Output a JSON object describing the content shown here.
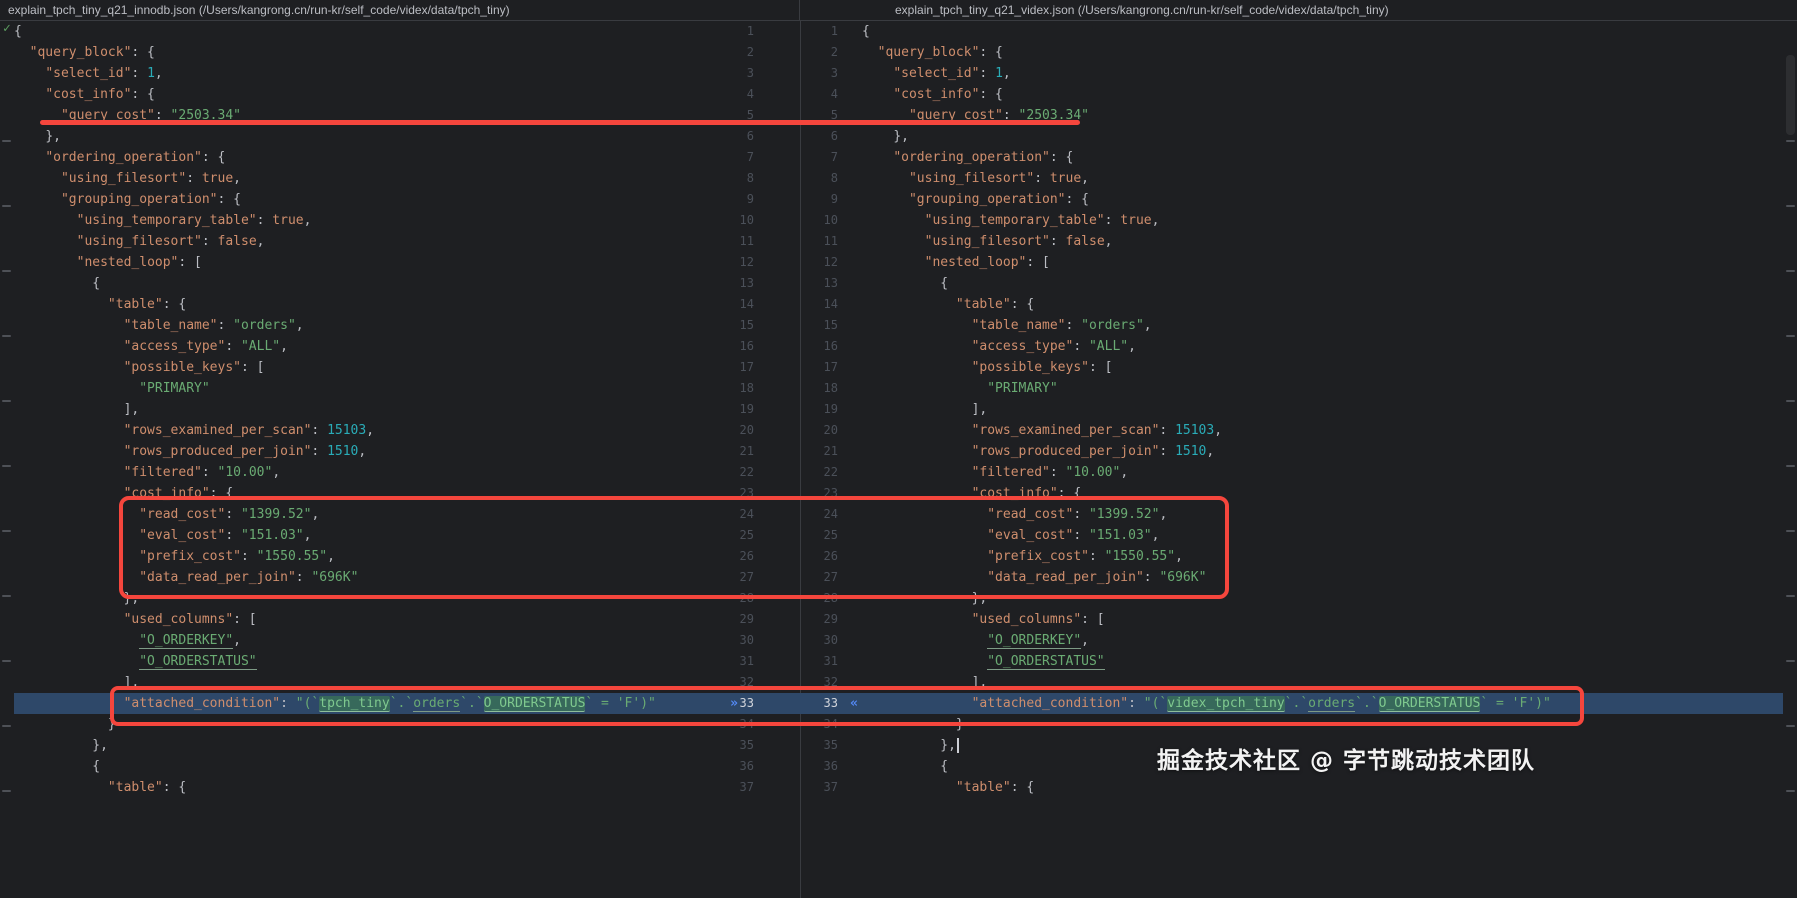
{
  "left_pane": {
    "header": "explain_tpch_tiny_q21_innodb.json (/Users/kangrong.cn/run-kr/self_code/videx/data/tpch_tiny)"
  },
  "right_pane": {
    "header": "explain_tpch_tiny_q21_videx.json (/Users/kangrong.cn/run-kr/self_code/videx/data/tpch_tiny)"
  },
  "watermark": "掘金技术社区 @ 字节跳动技术团队",
  "icons": {
    "inspection_ok": "✓",
    "chevron_next": "»",
    "chevron_prev": "«"
  },
  "colors": {
    "bg": "#1E1F22",
    "border": "#393B40",
    "header_fg": "#BCBEC4",
    "key": "#CF8E6D",
    "string": "#6AAB73",
    "number": "#2AACB8",
    "bool": "#CF8E6D",
    "punct": "#BCBEC4",
    "line_number": "#4B5059",
    "changed_line_bg": "#2E4869",
    "word_change_bg": "#37695B",
    "annotation": "#F5463D",
    "chevron": "#548AF7",
    "check": "#5C9E60"
  },
  "editor": {
    "lines": [
      {
        "n": 1,
        "t": [
          [
            "pun",
            "{"
          ]
        ]
      },
      {
        "n": 2,
        "t": [
          [
            "ws",
            "  "
          ],
          [
            "key",
            "\"query_block\""
          ],
          [
            "pun",
            ": {"
          ]
        ]
      },
      {
        "n": 3,
        "t": [
          [
            "ws",
            "    "
          ],
          [
            "key",
            "\"select_id\""
          ],
          [
            "pun",
            ": "
          ],
          [
            "num",
            "1"
          ],
          [
            "pun",
            ","
          ]
        ]
      },
      {
        "n": 4,
        "t": [
          [
            "ws",
            "    "
          ],
          [
            "key",
            "\"cost_info\""
          ],
          [
            "pun",
            ": {"
          ]
        ]
      },
      {
        "n": 5,
        "t": [
          [
            "ws",
            "      "
          ],
          [
            "key",
            "\"query_cost\""
          ],
          [
            "pun",
            ": "
          ],
          [
            "str",
            "\"2503.34\""
          ]
        ]
      },
      {
        "n": 6,
        "t": [
          [
            "ws",
            "    "
          ],
          [
            "pun",
            "},"
          ]
        ]
      },
      {
        "n": 7,
        "t": [
          [
            "ws",
            "    "
          ],
          [
            "key",
            "\"ordering_operation\""
          ],
          [
            "pun",
            ": {"
          ]
        ]
      },
      {
        "n": 8,
        "t": [
          [
            "ws",
            "      "
          ],
          [
            "key",
            "\"using_filesort\""
          ],
          [
            "pun",
            ": "
          ],
          [
            "bool",
            "true"
          ],
          [
            "pun",
            ","
          ]
        ]
      },
      {
        "n": 9,
        "t": [
          [
            "ws",
            "      "
          ],
          [
            "key",
            "\"grouping_operation\""
          ],
          [
            "pun",
            ": {"
          ]
        ]
      },
      {
        "n": 10,
        "t": [
          [
            "ws",
            "        "
          ],
          [
            "key",
            "\"using_temporary_table\""
          ],
          [
            "pun",
            ": "
          ],
          [
            "bool",
            "true"
          ],
          [
            "pun",
            ","
          ]
        ]
      },
      {
        "n": 11,
        "t": [
          [
            "ws",
            "        "
          ],
          [
            "key",
            "\"using_filesort\""
          ],
          [
            "pun",
            ": "
          ],
          [
            "bool",
            "false"
          ],
          [
            "pun",
            ","
          ]
        ]
      },
      {
        "n": 12,
        "t": [
          [
            "ws",
            "        "
          ],
          [
            "key",
            "\"nested_loop\""
          ],
          [
            "pun",
            ": ["
          ]
        ]
      },
      {
        "n": 13,
        "t": [
          [
            "ws",
            "          "
          ],
          [
            "pun",
            "{"
          ]
        ]
      },
      {
        "n": 14,
        "t": [
          [
            "ws",
            "            "
          ],
          [
            "key",
            "\"table\""
          ],
          [
            "pun",
            ": {"
          ]
        ]
      },
      {
        "n": 15,
        "t": [
          [
            "ws",
            "              "
          ],
          [
            "key",
            "\"table_name\""
          ],
          [
            "pun",
            ": "
          ],
          [
            "str",
            "\"orders\""
          ],
          [
            "pun",
            ","
          ]
        ]
      },
      {
        "n": 16,
        "t": [
          [
            "ws",
            "              "
          ],
          [
            "key",
            "\"access_type\""
          ],
          [
            "pun",
            ": "
          ],
          [
            "str",
            "\"ALL\""
          ],
          [
            "pun",
            ","
          ]
        ]
      },
      {
        "n": 17,
        "t": [
          [
            "ws",
            "              "
          ],
          [
            "key",
            "\"possible_keys\""
          ],
          [
            "pun",
            ": ["
          ]
        ]
      },
      {
        "n": 18,
        "t": [
          [
            "ws",
            "                "
          ],
          [
            "str",
            "\"PRIMARY\""
          ]
        ]
      },
      {
        "n": 19,
        "t": [
          [
            "ws",
            "              "
          ],
          [
            "pun",
            "],"
          ]
        ]
      },
      {
        "n": 20,
        "t": [
          [
            "ws",
            "              "
          ],
          [
            "key",
            "\"rows_examined_per_scan\""
          ],
          [
            "pun",
            ": "
          ],
          [
            "num",
            "15103"
          ],
          [
            "pun",
            ","
          ]
        ]
      },
      {
        "n": 21,
        "t": [
          [
            "ws",
            "              "
          ],
          [
            "key",
            "\"rows_produced_per_join\""
          ],
          [
            "pun",
            ": "
          ],
          [
            "num",
            "1510"
          ],
          [
            "pun",
            ","
          ]
        ]
      },
      {
        "n": 22,
        "t": [
          [
            "ws",
            "              "
          ],
          [
            "key",
            "\"filtered\""
          ],
          [
            "pun",
            ": "
          ],
          [
            "str",
            "\"10.00\""
          ],
          [
            "pun",
            ","
          ]
        ]
      },
      {
        "n": 23,
        "t": [
          [
            "ws",
            "              "
          ],
          [
            "key",
            "\"cost_info\""
          ],
          [
            "pun",
            ": {"
          ]
        ]
      },
      {
        "n": 24,
        "t": [
          [
            "ws",
            "                "
          ],
          [
            "key",
            "\"read_cost\""
          ],
          [
            "pun",
            ": "
          ],
          [
            "str",
            "\"1399.52\""
          ],
          [
            "pun",
            ","
          ]
        ]
      },
      {
        "n": 25,
        "t": [
          [
            "ws",
            "                "
          ],
          [
            "key",
            "\"eval_cost\""
          ],
          [
            "pun",
            ": "
          ],
          [
            "str",
            "\"151.03\""
          ],
          [
            "pun",
            ","
          ]
        ]
      },
      {
        "n": 26,
        "t": [
          [
            "ws",
            "                "
          ],
          [
            "key",
            "\"prefix_cost\""
          ],
          [
            "pun",
            ": "
          ],
          [
            "str",
            "\"1550.55\""
          ],
          [
            "pun",
            ","
          ]
        ]
      },
      {
        "n": 27,
        "t": [
          [
            "ws",
            "                "
          ],
          [
            "key",
            "\"data_read_per_join\""
          ],
          [
            "pun",
            ": "
          ],
          [
            "str",
            "\"696K\""
          ]
        ]
      },
      {
        "n": 28,
        "t": [
          [
            "ws",
            "              "
          ],
          [
            "pun",
            "},"
          ]
        ]
      },
      {
        "n": 29,
        "t": [
          [
            "ws",
            "              "
          ],
          [
            "key",
            "\"used_columns\""
          ],
          [
            "pun",
            ": ["
          ]
        ]
      },
      {
        "n": 30,
        "t": [
          [
            "ws",
            "                "
          ],
          [
            "strU",
            "\"O_ORDERKEY\""
          ],
          [
            "pun",
            ","
          ]
        ]
      },
      {
        "n": 31,
        "t": [
          [
            "ws",
            "                "
          ],
          [
            "strU",
            "\"O_ORDERSTATUS\""
          ]
        ]
      },
      {
        "n": 32,
        "t": [
          [
            "ws",
            "              "
          ],
          [
            "pun",
            "],"
          ]
        ]
      },
      {
        "n": 33,
        "changed": true,
        "lt": [
          [
            "ws",
            "              "
          ],
          [
            "key",
            "\"attached_condition\""
          ],
          [
            "pun",
            ": "
          ],
          [
            "str",
            "\"(`"
          ],
          [
            "strHL",
            "tpch_tiny"
          ],
          [
            "str",
            "`.`"
          ],
          [
            "strU",
            "orders"
          ],
          [
            "str",
            "`.`"
          ],
          [
            "strHL",
            "O_ORDERSTATUS"
          ],
          [
            "str",
            "` = 'F')\""
          ]
        ],
        "rt": [
          [
            "ws",
            "              "
          ],
          [
            "key",
            "\"attached_condition\""
          ],
          [
            "pun",
            ": "
          ],
          [
            "str",
            "\"(`"
          ],
          [
            "strHL",
            "videx_tpch_tiny"
          ],
          [
            "str",
            "`.`"
          ],
          [
            "strU",
            "orders"
          ],
          [
            "str",
            "`.`"
          ],
          [
            "strHL",
            "O_ORDERSTATUS"
          ],
          [
            "str",
            "` = 'F')\""
          ]
        ]
      },
      {
        "n": 34,
        "t": [
          [
            "ws",
            "            "
          ],
          [
            "pun",
            "}"
          ]
        ]
      },
      {
        "n": 35,
        "t": [
          [
            "ws",
            "          "
          ],
          [
            "pun",
            "},"
          ]
        ],
        "rt": [
          [
            "ws",
            "          "
          ],
          [
            "pun",
            "},"
          ],
          [
            "caret",
            ""
          ]
        ]
      },
      {
        "n": 36,
        "t": [
          [
            "ws",
            "          "
          ],
          [
            "pun",
            "{"
          ]
        ]
      },
      {
        "n": 37,
        "t": [
          [
            "ws",
            "            "
          ],
          [
            "key",
            "\"table\""
          ],
          [
            "pun",
            ": {"
          ]
        ]
      }
    ]
  }
}
